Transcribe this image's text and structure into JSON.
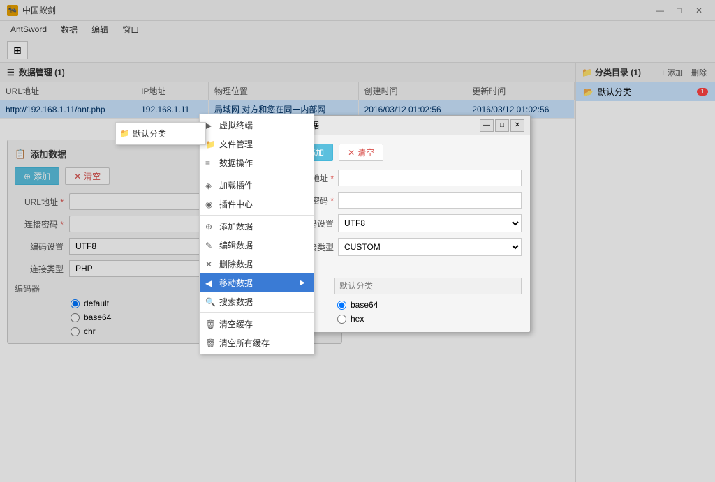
{
  "app": {
    "title": "中国蚁剑",
    "icon": "🐜"
  },
  "titlebar": {
    "minimize": "—",
    "maximize": "□",
    "close": "✕"
  },
  "menubar": {
    "items": [
      "AntSword",
      "数据",
      "编辑",
      "窗口"
    ]
  },
  "toolbar": {
    "home_icon": "⊞"
  },
  "data_manager": {
    "title": "数据管理 (1)",
    "columns": [
      "URL地址",
      "IP地址",
      "物理位置",
      "创建时间",
      "更新时间"
    ],
    "rows": [
      {
        "url": "http://192.168.1.11/ant.php",
        "ip": "192.168.1.11",
        "location": "局域网 对方和您在同一内部网",
        "created": "2016/03/12 01:02:56",
        "updated": "2016/03/12 01:02:56"
      }
    ]
  },
  "category_panel": {
    "title": "分类目录 (1)",
    "add_label": "+ 添加",
    "delete_label": "删除",
    "items": [
      {
        "name": "默认分类",
        "count": "1"
      }
    ]
  },
  "add_form_bg": {
    "title": "添加数据",
    "add_btn": "添加",
    "clear_btn": "清空",
    "url_label": "URL地址",
    "password_label": "连接密码",
    "encoding_label": "编码设置",
    "encoding_value": "UTF8",
    "type_label": "连接类型",
    "type_value": "PHP",
    "encoder_label": "编码器",
    "encoder_section": "编码器",
    "options": [
      "default",
      "base64",
      "chr"
    ]
  },
  "modal": {
    "title": "添加数据",
    "minimize": "—",
    "maximize": "□",
    "close": "✕",
    "add_btn": "添加",
    "clear_btn": "清空",
    "url_label": "URL地址",
    "password_label": "连接密码",
    "encoding_label": "编码设置",
    "encoding_value": "UTF8",
    "type_label": "连接类型",
    "type_value": "CUSTOM",
    "encoder_label": "编码器",
    "category_placeholder": "默认分类",
    "encoder_options": [
      "base64",
      "hex"
    ]
  },
  "context_menu": {
    "items": [
      {
        "icon": "▶",
        "label": "虚拟终端",
        "shortcut": ""
      },
      {
        "icon": "📁",
        "label": "文件管理",
        "shortcut": ""
      },
      {
        "icon": "≡",
        "label": "数据操作",
        "shortcut": ""
      },
      {
        "divider": true
      },
      {
        "icon": "◈",
        "label": "加载插件",
        "shortcut": ""
      },
      {
        "icon": "◉",
        "label": "插件中心",
        "shortcut": ""
      },
      {
        "divider": true
      },
      {
        "icon": "⊕",
        "label": "添加数据",
        "shortcut": ""
      },
      {
        "icon": "✎",
        "label": "编辑数据",
        "shortcut": ""
      },
      {
        "icon": "✕",
        "label": "删除数据",
        "shortcut": ""
      },
      {
        "icon": "◀",
        "label": "移动数据",
        "shortcut": "▶",
        "active": true
      },
      {
        "icon": "🔍",
        "label": "搜索数据",
        "shortcut": ""
      },
      {
        "divider": true
      },
      {
        "icon": "🗑",
        "label": "清空缓存",
        "shortcut": ""
      },
      {
        "icon": "🗑",
        "label": "清空所有缓存",
        "shortcut": ""
      }
    ],
    "submenu": [
      {
        "icon": "📁",
        "label": "默认分类"
      }
    ]
  }
}
